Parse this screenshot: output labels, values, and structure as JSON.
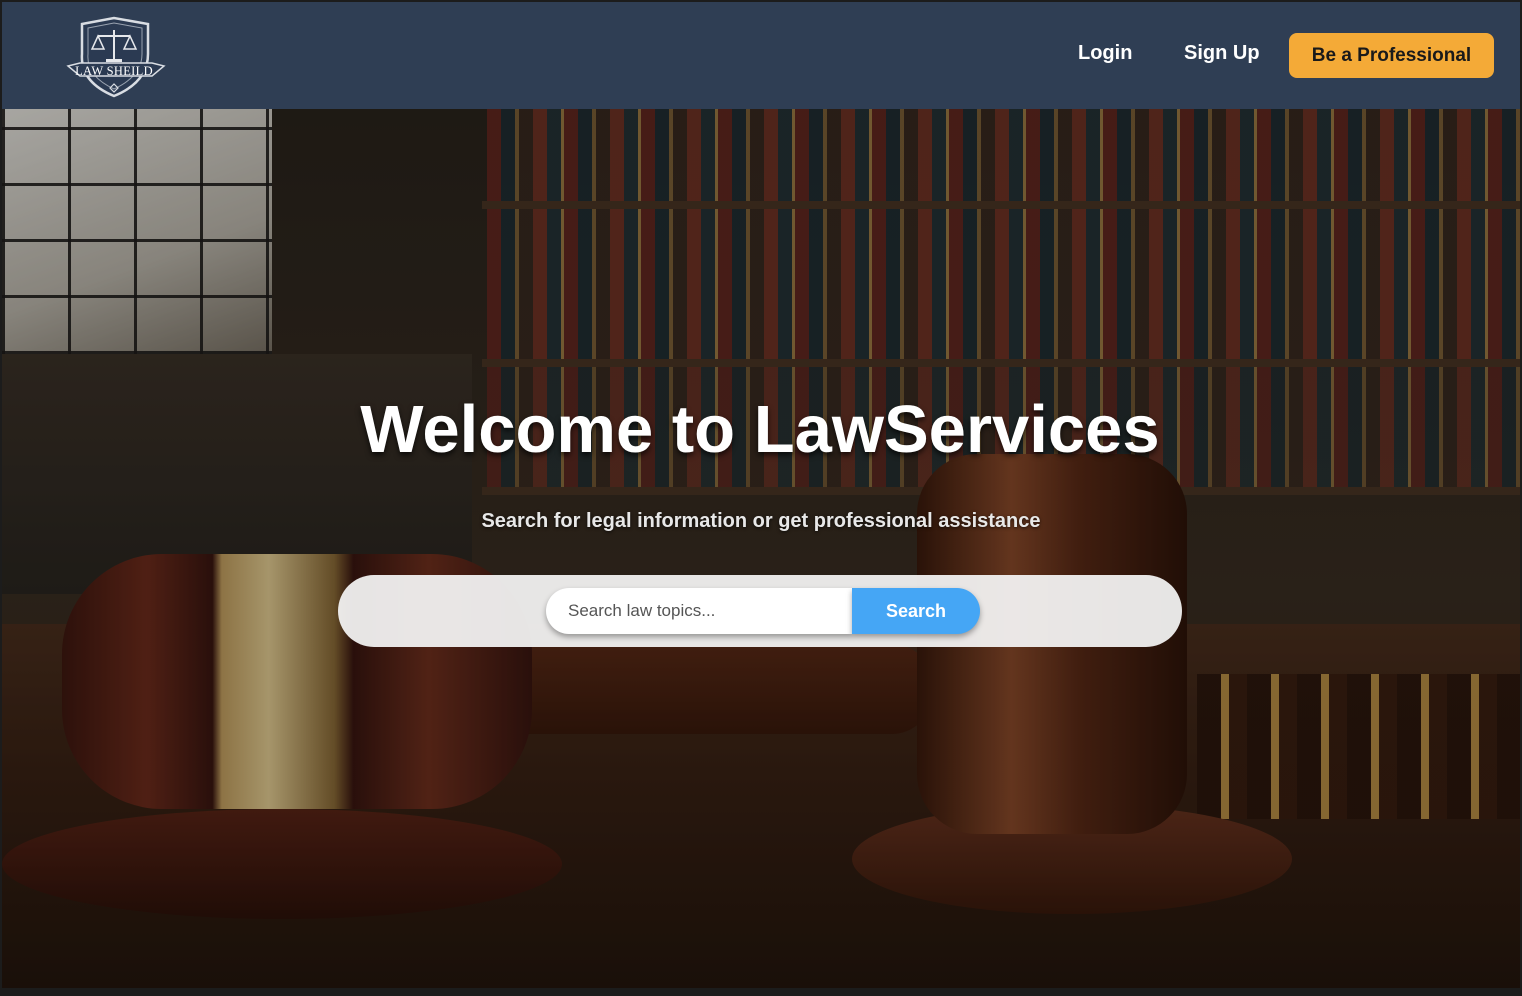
{
  "header": {
    "logo_text": "LAW SHEILD",
    "logo_icon": "scales-shield-icon",
    "nav": {
      "login_label": "Login",
      "signup_label": "Sign Up",
      "professional_label": "Be a Professional"
    }
  },
  "hero": {
    "title": "Welcome to LawServices",
    "subtitle": "Search for legal information or get professional assistance",
    "search": {
      "placeholder": "Search law topics...",
      "value": "",
      "button_label": "Search"
    }
  },
  "colors": {
    "navbar_bg": "#2f3e54",
    "accent_button": "#f4aa37",
    "search_button": "#45a6f5",
    "text_light": "#ffffff"
  }
}
